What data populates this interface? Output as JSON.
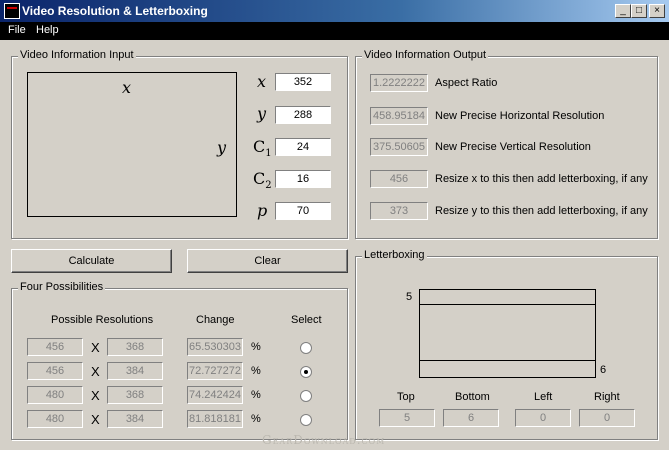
{
  "window": {
    "title": "Video Resolution & Letterboxing",
    "min": "_",
    "max": "□",
    "close": "×"
  },
  "menu": {
    "file": "File",
    "help": "Help"
  },
  "input": {
    "label": "Video Information Input",
    "preview_x": "x",
    "preview_y": "y",
    "x_label": "x",
    "x": "352",
    "y_label": "y",
    "y": "288",
    "c1_label": "C",
    "c1_sub": "1",
    "c1": "24",
    "c2_label": "C",
    "c2_sub": "2",
    "c2": "16",
    "p_label": "p",
    "p": "70"
  },
  "output": {
    "label": "Video Information Output",
    "aspect_value": "1.2222222",
    "aspect_label": "Aspect Ratio",
    "horiz_value": "458.95184",
    "horiz_label": "New Precise Horizontal Resolution",
    "vert_value": "375.50605",
    "vert_label": "New Precise Vertical Resolution",
    "resize_x_value": "456",
    "resize_x_label": "Resize x to this then add letterboxing, if any",
    "resize_y_value": "373",
    "resize_y_label": "Resize y to this then add letterboxing, if any"
  },
  "buttons": {
    "calculate": "Calculate",
    "clear": "Clear"
  },
  "possibilities": {
    "label": "Four Possibilities",
    "col_res": "Possible Resolutions",
    "col_change": "Change",
    "col_select": "Select",
    "sep": "X",
    "pct": "%",
    "rows": [
      {
        "w": "456",
        "h": "368",
        "change": "65.530303",
        "selected": false
      },
      {
        "w": "456",
        "h": "384",
        "change": "72.727272",
        "selected": true
      },
      {
        "w": "480",
        "h": "368",
        "change": "74.242424",
        "selected": false
      },
      {
        "w": "480",
        "h": "384",
        "change": "81.818181",
        "selected": false
      }
    ]
  },
  "letterboxing": {
    "label": "Letterboxing",
    "top_marker": "5",
    "bottom_marker": "6",
    "top_label": "Top",
    "top": "5",
    "bottom_label": "Bottom",
    "bottom": "6",
    "left_label": "Left",
    "left": "0",
    "right_label": "Right",
    "right": "0"
  },
  "watermark": "GearDownload.com"
}
